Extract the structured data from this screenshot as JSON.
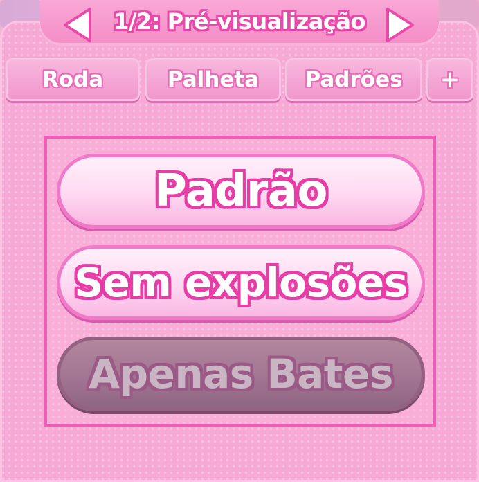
{
  "header": {
    "title": "1/2: Pré-visualização",
    "prev_icon": "triangle-left-icon",
    "next_icon": "triangle-right-icon"
  },
  "tabs": [
    {
      "label": "Roda"
    },
    {
      "label": "Palheta"
    },
    {
      "label": "Padrões"
    },
    {
      "label": "+"
    }
  ],
  "options": [
    {
      "label": "Padrão",
      "state": "enabled"
    },
    {
      "label": "Sem explosões",
      "state": "enabled"
    },
    {
      "label": "Apenas Bates",
      "state": "disabled"
    }
  ],
  "colors": {
    "panel": "#f7a9d6",
    "accent": "#e94aa9",
    "button_light": "#ffd8f1",
    "button_disabled": "#a07390"
  }
}
